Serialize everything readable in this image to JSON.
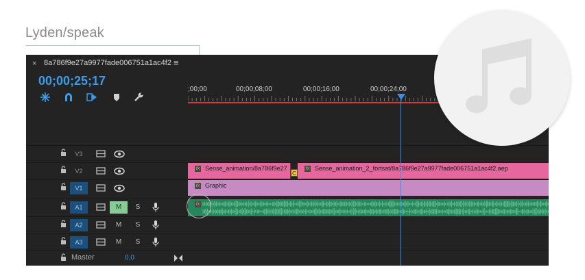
{
  "annotation": {
    "label": "Lyden/speak"
  },
  "sequence": {
    "name": "8a786f9e27a9977fade006751a1ac4f2",
    "timecode": "00;00;25;17",
    "close_glyph": "×",
    "menu_glyph": "≡"
  },
  "ruler": {
    "labels": [
      ";00;00",
      "00;00;08;00",
      "00;00;16;00",
      "00;00;24;00"
    ]
  },
  "tracks": {
    "video": [
      {
        "name": "V3",
        "active": false
      },
      {
        "name": "V2",
        "active": false
      },
      {
        "name": "V1",
        "active": true
      }
    ],
    "audio": [
      {
        "name": "A1",
        "active": true,
        "mute": "M",
        "solo": "S",
        "mute_on": true
      },
      {
        "name": "A2",
        "active": true,
        "mute": "M",
        "solo": "S",
        "mute_on": false
      },
      {
        "name": "A3",
        "active": true,
        "mute": "M",
        "solo": "S",
        "mute_on": false
      }
    ],
    "master": {
      "label": "Master",
      "value": "0,0"
    }
  },
  "clips": {
    "v2_a": {
      "label": "Sense_animation/8a786f9e27"
    },
    "v2_a_badge": "C",
    "v2_b": {
      "label": "Sense_animation_2_fortsat/8a786f9e27a9977fade006751a1ac4f2.aep"
    },
    "v1": {
      "label": "Graphic"
    },
    "fx_glyph": "fx"
  },
  "icons": {
    "snap": "ripple-icon",
    "magnet": "magnet-icon",
    "linked": "linked-selection-icon",
    "marker": "marker-icon",
    "wrench": "wrench-icon",
    "music": "music-note-icon"
  },
  "colors": {
    "timecode": "#3f9ae8",
    "playhead": "#3f8fe6",
    "video_clip": "#e6679d",
    "graphic_clip": "#c78bc4",
    "audio_clip": "#27875c",
    "mute_on": "#87cc97",
    "track_active": "#1b4f7c"
  }
}
